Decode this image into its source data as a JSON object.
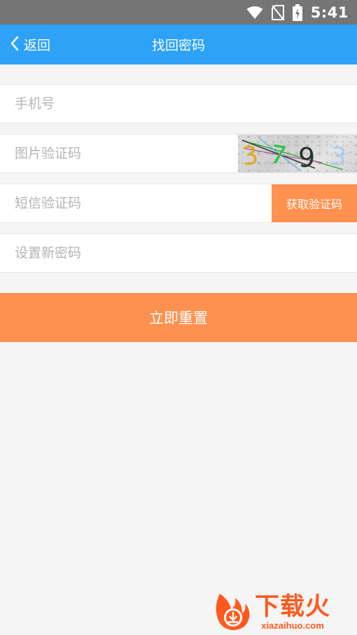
{
  "status_bar": {
    "time": "5:41",
    "icons": [
      "wifi-icon",
      "no-sim-icon",
      "battery-charging-icon"
    ]
  },
  "nav": {
    "back_label": "返回",
    "title": "找回密码",
    "background": "#2da2f7"
  },
  "form": {
    "phone": {
      "placeholder": "手机号",
      "value": ""
    },
    "image_code": {
      "placeholder": "图片验证码",
      "value": "",
      "captcha_chars": [
        "3",
        "7",
        "9",
        "3"
      ]
    },
    "sms_code": {
      "placeholder": "短信验证码",
      "value": "",
      "button_label": "获取验证码"
    },
    "new_password": {
      "placeholder": "设置新密码",
      "value": ""
    }
  },
  "submit": {
    "label": "立即重置",
    "background": "#ff9150"
  },
  "watermark": {
    "cn": "下载火",
    "en": "xiazaihuo.com"
  }
}
